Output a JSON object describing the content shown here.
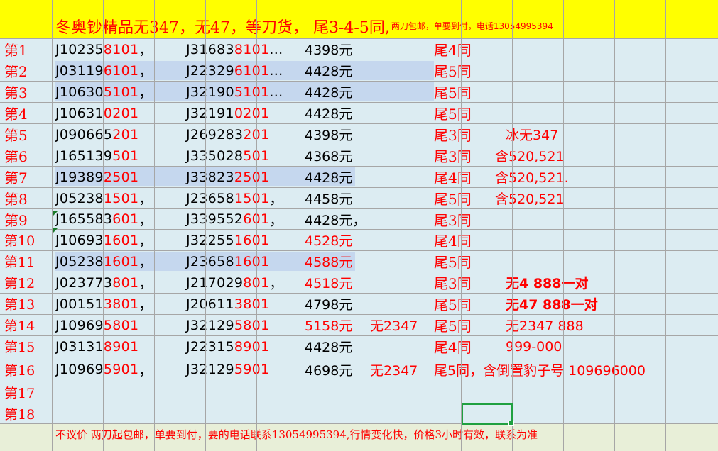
{
  "title": {
    "main": "冬奥钞精品无347，无47，等刀货，  尾3-4-5同,",
    "small": "两刀包邮，单要到付，电话13054995394"
  },
  "rows": [
    {
      "label": "第1",
      "c1": {
        "p": "J10235",
        "s": "8101",
        "t": "，"
      },
      "c2": {
        "p": "J31683",
        "s": "8101",
        "t": "..."
      },
      "price": "4398元",
      "price_red": false,
      "note_a": "",
      "tail": "尾4同",
      "note_b": ""
    },
    {
      "label": "第2",
      "c1": {
        "p": "J03119",
        "s": "6101",
        "t": "，"
      },
      "c2": {
        "p": "J22329",
        "s": "6101",
        "t": "..."
      },
      "price": "4428元",
      "price_red": false,
      "note_a": "",
      "tail": "尾5同",
      "note_b": ""
    },
    {
      "label": "第3",
      "c1": {
        "p": "J10630",
        "s": "5101",
        "t": "，"
      },
      "c2": {
        "p": "J32190",
        "s": "5101",
        "t": "..."
      },
      "price": "4428元",
      "price_red": false,
      "note_a": "",
      "tail": "尾5同",
      "note_b": ""
    },
    {
      "label": "第4",
      "c1": {
        "p": "J10631",
        "s": "0201",
        "t": ""
      },
      "c2": {
        "p": "J32191",
        "s": "0201",
        "t": ""
      },
      "price": "4428元",
      "price_red": false,
      "note_a": "",
      "tail": "尾5同",
      "note_b": ""
    },
    {
      "label": "第5",
      "c1": {
        "p": "J090665",
        "s": "201",
        "t": ""
      },
      "c2": {
        "p": "J269283",
        "s": "201",
        "t": ""
      },
      "price": "4398元",
      "price_red": false,
      "note_a": "",
      "tail": "尾3同",
      "note_b": "冰无347"
    },
    {
      "label": "第6",
      "c1": {
        "p": "J165139",
        "s": "501",
        "t": ""
      },
      "c2": {
        "p": "J335028",
        "s": "501",
        "t": ""
      },
      "price": "4368元",
      "price_red": false,
      "note_a": "",
      "tail": "尾3同",
      "note_b": "含520,521"
    },
    {
      "label": "第7",
      "c1": {
        "p": "J19389",
        "s": "2501",
        "t": ""
      },
      "c2": {
        "p": "J33823",
        "s": "2501",
        "t": ""
      },
      "price": "4428元",
      "price_red": false,
      "note_a": "",
      "tail": "尾4同",
      "note_b": "含520,521."
    },
    {
      "label": "第8",
      "c1": {
        "p": "J05238",
        "s": "1501",
        "t": "，"
      },
      "c2": {
        "p": "J23658",
        "s": "1501",
        "t": "，"
      },
      "price": "4458元",
      "price_red": false,
      "note_a": "",
      "tail": "尾5同",
      "note_b": "含520,521"
    },
    {
      "label": "第9",
      "c1": {
        "p": "J165583",
        "s": "601",
        "t": "，"
      },
      "c2": {
        "p": "J339552",
        "s": "601",
        "t": "，"
      },
      "price": "4428元，",
      "price_red": false,
      "note_a": "",
      "tail": "尾3同",
      "note_b": ""
    },
    {
      "label": "第10",
      "c1": {
        "p": "J10693",
        "s": "1601",
        "t": "，"
      },
      "c2": {
        "p": "J32255",
        "s": "1601",
        "t": ""
      },
      "price": "4528元",
      "price_red": true,
      "note_a": "",
      "tail": "尾4同",
      "note_b": ""
    },
    {
      "label": "第11",
      "c1": {
        "p": "J05238",
        "s": "1601",
        "t": "，"
      },
      "c2": {
        "p": "J23658",
        "s": "1601",
        "t": ""
      },
      "price": "4588元",
      "price_red": true,
      "note_a": "",
      "tail": "尾5同",
      "note_b": ""
    },
    {
      "label": "第12",
      "c1": {
        "p": "J023773",
        "s": "801",
        "t": "，"
      },
      "c2": {
        "p": "J217029",
        "s": "801",
        "t": "，"
      },
      "price": "4518元",
      "price_red": true,
      "note_a": "",
      "tail": "尾3同",
      "note_b": "无4   888一对"
    },
    {
      "label": "第13",
      "c1": {
        "p": "J00151",
        "s": "3801",
        "t": "，"
      },
      "c2": {
        "p": "J20611",
        "s": "3801",
        "t": ""
      },
      "price": "4798元",
      "price_red": false,
      "note_a": "",
      "tail": "尾5同",
      "note_b": "无47  888一对"
    },
    {
      "label": "第14",
      "c1": {
        "p": "J10969",
        "s": "5801",
        "t": ""
      },
      "c2": {
        "p": "J32129",
        "s": "5801",
        "t": ""
      },
      "price": "5158元",
      "price_red": true,
      "note_a": "无2347",
      "tail": "尾5同",
      "note_b": "无2347   888"
    },
    {
      "label": "第15",
      "c1": {
        "p": "J03131",
        "s": "8901",
        "t": ""
      },
      "c2": {
        "p": "J22315",
        "s": "8901",
        "t": ""
      },
      "price": "4428元",
      "price_red": false,
      "note_a": "",
      "tail": "尾4同",
      "note_b": "999-000"
    },
    {
      "label": "第16",
      "c1": {
        "p": "J10969",
        "s": "5901",
        "t": "，"
      },
      "c2": {
        "p": "J32129",
        "s": "5901",
        "t": ""
      },
      "price": "4698元",
      "price_red": false,
      "note_a": "无2347",
      "tail": "尾5同，含倒置豹子号 109696000",
      "note_b": ""
    },
    {
      "label": "第17",
      "empty": true
    },
    {
      "label": "第18",
      "empty": true
    }
  ],
  "footer": "不议价 两刀起包邮，单要到付，要的电话联系13054995394,行情变化快，价格3小时有效，联系为准",
  "colors": {
    "title_bg": "#ffff00",
    "text_red": "#ff0000",
    "cell_bg": "#dcecf2",
    "highlight": "#c5d7ee",
    "selection": "#20a040",
    "footer_bg": "#e8efd8"
  }
}
